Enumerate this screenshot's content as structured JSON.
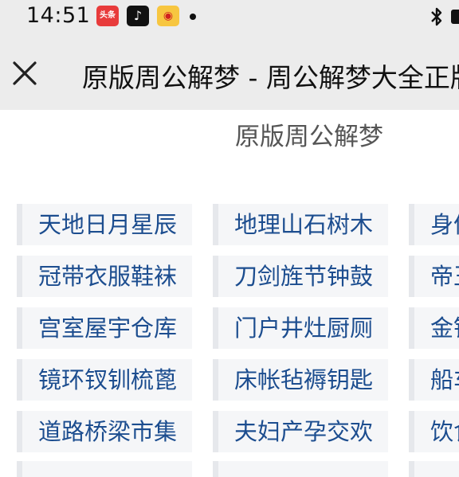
{
  "status_bar": {
    "time": "14:51",
    "apps": [
      {
        "name": "toutiao",
        "label": "头条"
      },
      {
        "name": "douyin",
        "label": "♪"
      },
      {
        "name": "weibo",
        "label": "◉"
      }
    ]
  },
  "nav": {
    "title": "原版周公解梦 - 周公解梦大全正版"
  },
  "page": {
    "heading": "原版周公解梦"
  },
  "grid": {
    "rows": [
      [
        "天地日月星辰",
        "地理山石树木",
        "身体人物"
      ],
      [
        "冠带衣服鞋袜",
        "刀剑旌节钟鼓",
        "帝王圣贤"
      ],
      [
        "宫室屋宇仓库",
        "门户井灶厨厕",
        "金银珠宝"
      ],
      [
        "镜环钗钏梳蓖",
        "床帐毡褥钥匙",
        "船车桥梁"
      ],
      [
        "道路桥梁市集",
        "夫妇产孕交欢",
        "饮食酒肉"
      ]
    ]
  }
}
